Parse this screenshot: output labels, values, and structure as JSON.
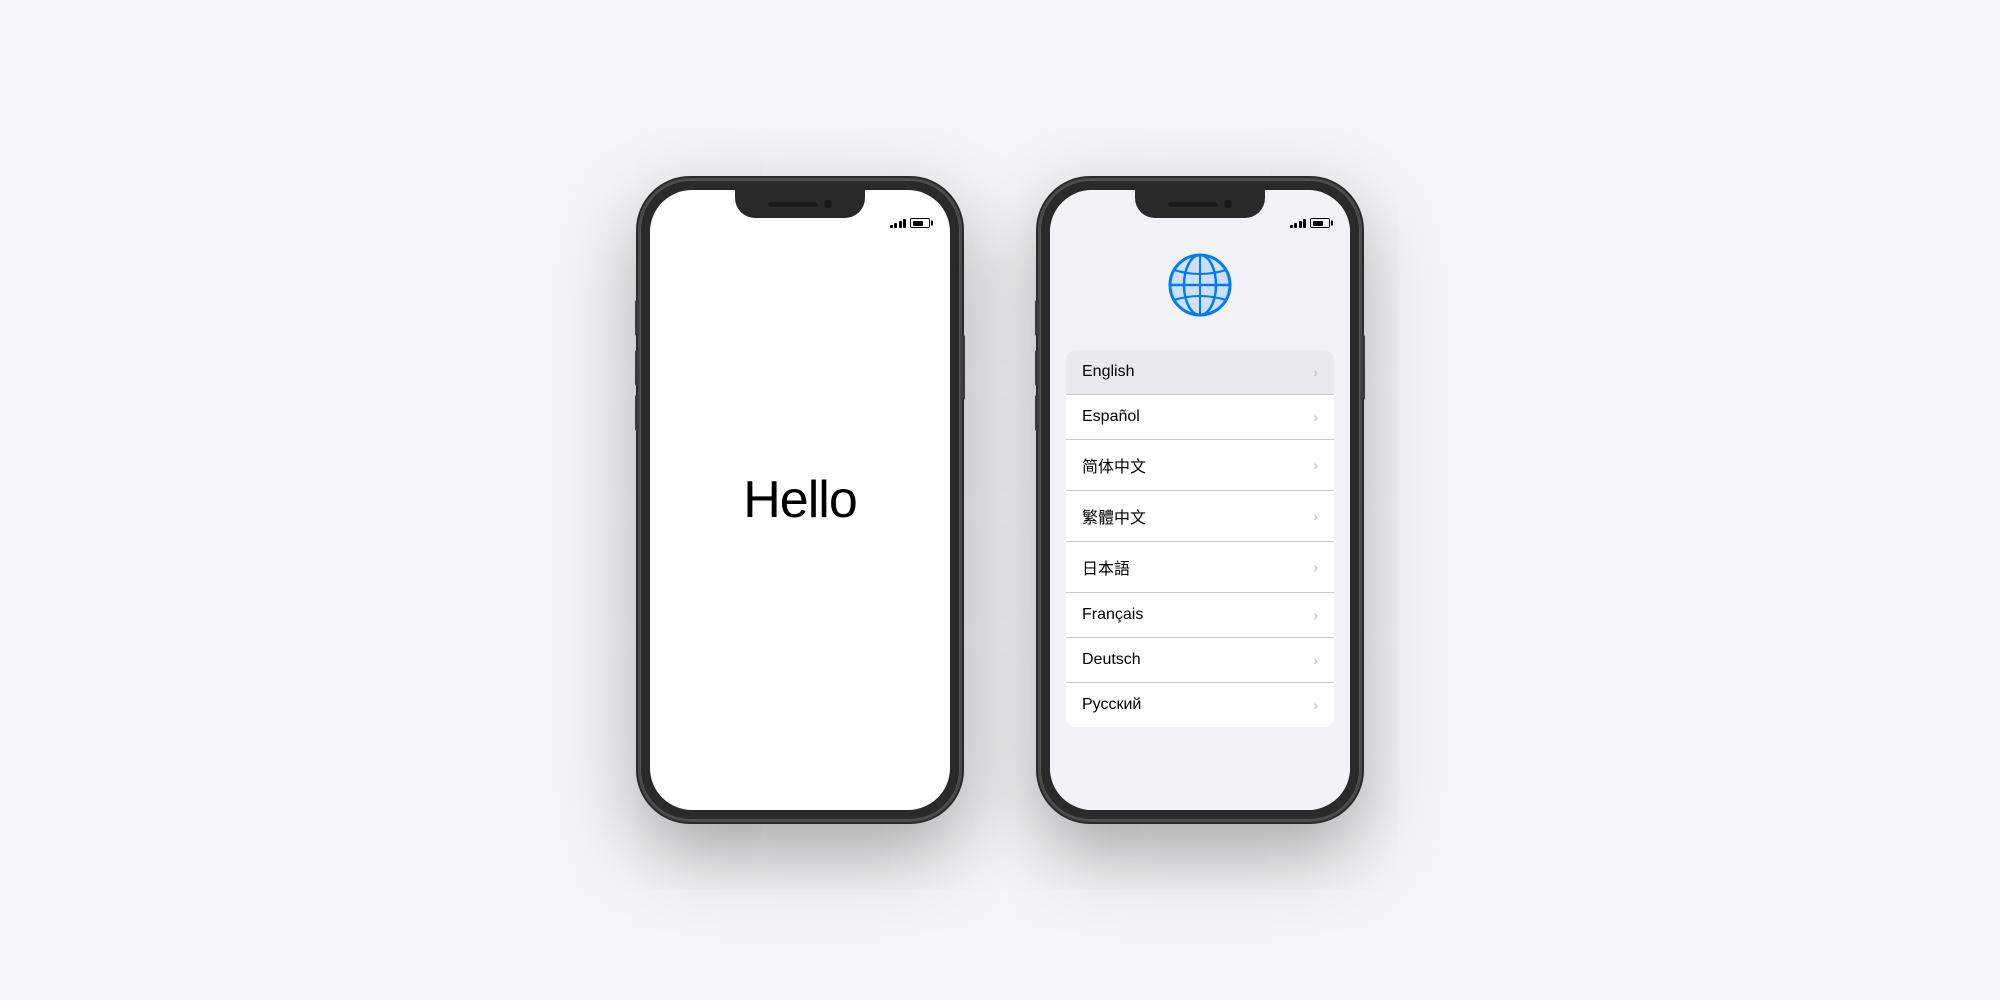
{
  "phone1": {
    "hello_text": "Hello"
  },
  "phone2": {
    "languages": [
      {
        "id": "english",
        "label": "English",
        "selected": true
      },
      {
        "id": "espanol",
        "label": "Español",
        "selected": false
      },
      {
        "id": "simplified-chinese",
        "label": "简体中文",
        "selected": false
      },
      {
        "id": "traditional-chinese",
        "label": "繁體中文",
        "selected": false
      },
      {
        "id": "japanese",
        "label": "日本語",
        "selected": false
      },
      {
        "id": "french",
        "label": "Français",
        "selected": false
      },
      {
        "id": "german",
        "label": "Deutsch",
        "selected": false
      },
      {
        "id": "russian",
        "label": "Русский",
        "selected": false
      }
    ]
  },
  "status": {
    "signal_bars": [
      3,
      4,
      5,
      6,
      7
    ],
    "battery_label": "Battery"
  }
}
